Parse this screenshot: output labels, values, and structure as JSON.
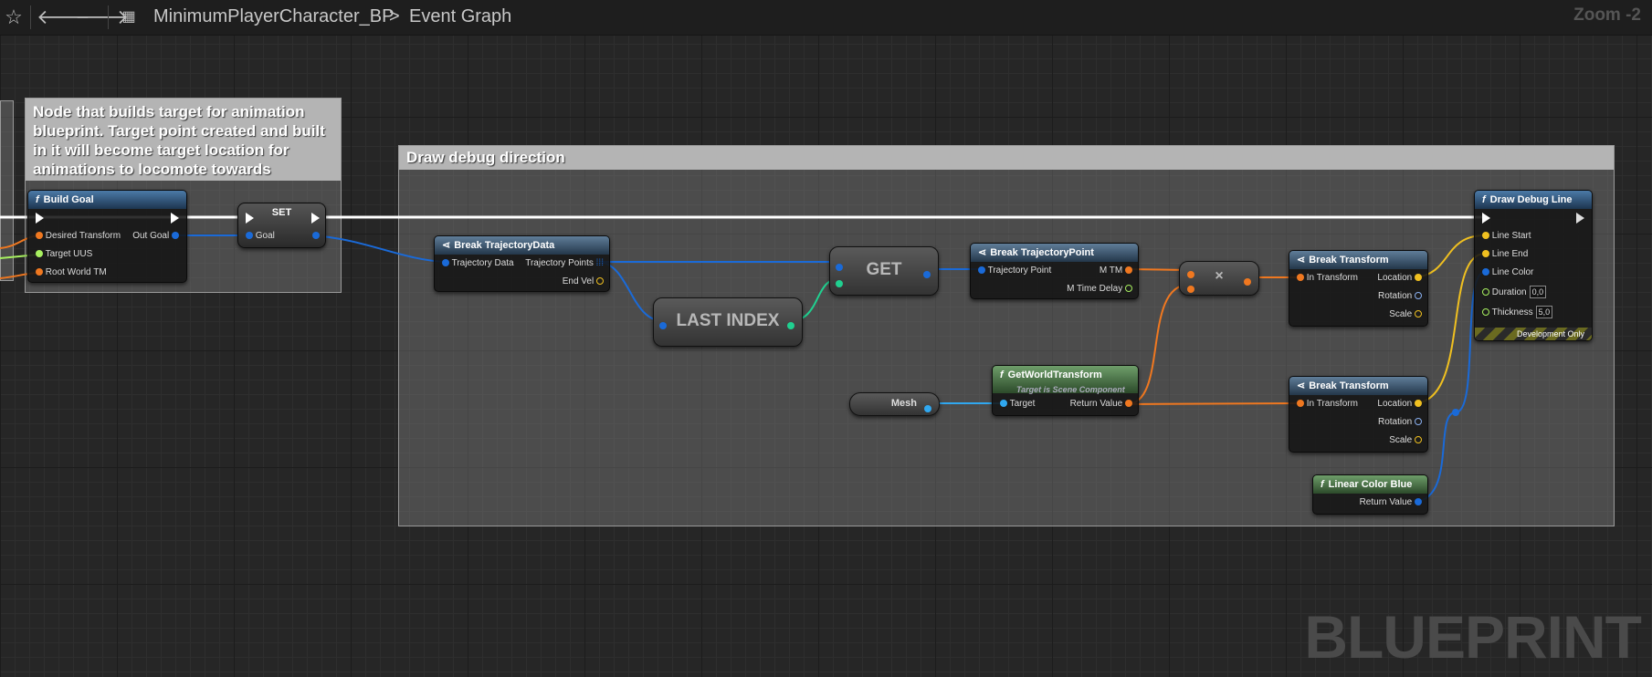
{
  "toolbar": {
    "breadcrumb_root": "MinimumPlayerCharacter_BP",
    "breadcrumb_sep": ">",
    "breadcrumb_leaf": "Event Graph",
    "zoom": "Zoom -2",
    "icons": [
      "star-icon",
      "back-arrow-icon",
      "forward-arrow-icon",
      "blueprint-graph-icon"
    ]
  },
  "watermark": "BLUEPRINT",
  "comments": {
    "left_text": "Node that builds target for animation blueprint. Target point created and built in it will become target location for animations to locomote towards",
    "debug_title": "Draw debug direction"
  },
  "nodes": {
    "build_goal": {
      "title": "Build Goal",
      "pin_desired": "Desired Transform",
      "pin_target": "Target UUS",
      "pin_root": "Root World TM",
      "pin_out": "Out Goal"
    },
    "set": {
      "title": "SET",
      "pin_goal": "Goal"
    },
    "break_traj_data": {
      "title": "Break TrajectoryData",
      "pin_in": "Trajectory Data",
      "pin_points": "Trajectory Points",
      "pin_vel": "End Vel"
    },
    "last_index": {
      "title": "LAST INDEX"
    },
    "get": {
      "title": "GET"
    },
    "break_traj_point": {
      "title": "Break TrajectoryPoint",
      "pin_in": "Trajectory Point",
      "pin_mtm": "M TM",
      "pin_delay": "M Time Delay"
    },
    "multiply": {
      "title": "×"
    },
    "mesh": {
      "title": "Mesh"
    },
    "get_world_transform": {
      "title": "GetWorldTransform",
      "subtitle": "Target is Scene Component",
      "pin_target": "Target",
      "pin_ret": "Return Value"
    },
    "break_transform_1": {
      "title": "Break Transform",
      "pin_in": "In Transform",
      "pin_loc": "Location",
      "pin_rot": "Rotation",
      "pin_scale": "Scale"
    },
    "break_transform_2": {
      "title": "Break Transform",
      "pin_in": "In Transform",
      "pin_loc": "Location",
      "pin_rot": "Rotation",
      "pin_scale": "Scale"
    },
    "linear_color_blue": {
      "title": "Linear Color Blue",
      "pin_ret": "Return Value"
    },
    "draw_debug_line": {
      "title": "Draw Debug Line",
      "pin_start": "Line Start",
      "pin_end": "Line End",
      "pin_color": "Line Color",
      "pin_duration": "Duration",
      "duration_value": "0,0",
      "pin_thickness": "Thickness",
      "thickness_value": "5,0",
      "dev_only": "Development Only"
    }
  },
  "colors": {
    "transform": "#f07820",
    "vector": "#f0c020",
    "struct": "#1a6ad8",
    "int": "#20d090",
    "float": "#a8f060",
    "object": "#30a8f0",
    "exec": "#ffffff"
  }
}
